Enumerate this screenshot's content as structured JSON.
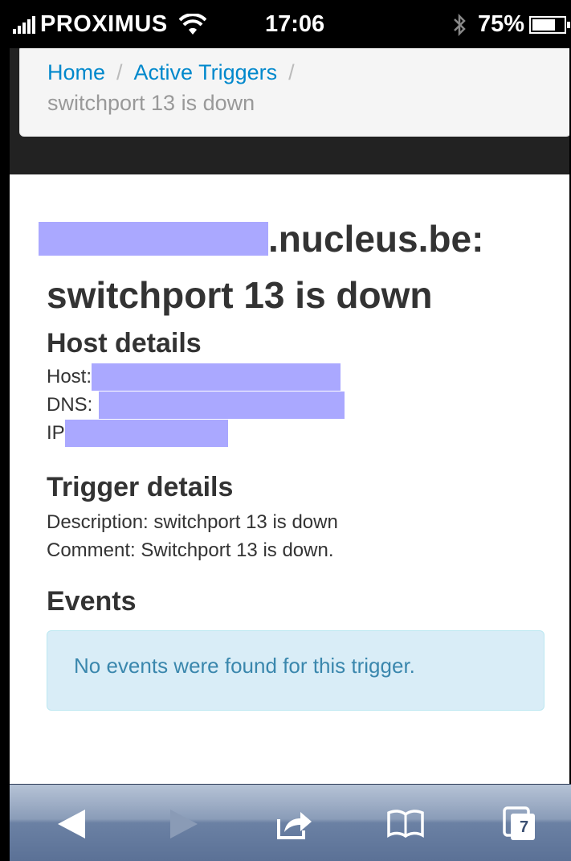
{
  "status_bar": {
    "carrier": "PROXIMUS",
    "time": "17:06",
    "battery": "75%",
    "battery_level": 0.75
  },
  "breadcrumb": {
    "home": "Home",
    "sep1": "/",
    "active_triggers": "Active Triggers",
    "sep2": "/",
    "current": "switchport 13 is down"
  },
  "title": {
    "host_suffix": ".nucleus.be:",
    "trigger": "switchport 13 is down"
  },
  "host_details": {
    "heading": "Host details",
    "host_label": "Host:",
    "dns_label": "DNS:",
    "ip_label": "IP"
  },
  "trigger_details": {
    "heading": "Trigger details",
    "description": "Description: switchport 13 is down",
    "comment": "Comment: Switchport 13 is down."
  },
  "events": {
    "heading": "Events",
    "empty_message": "No events were found for this trigger."
  },
  "toolbar": {
    "tabs_count": "7"
  },
  "colors": {
    "link": "#0088cc",
    "redaction": "#aaa8ff",
    "alert_bg": "#d9edf7",
    "alert_text": "#3a87ad"
  }
}
